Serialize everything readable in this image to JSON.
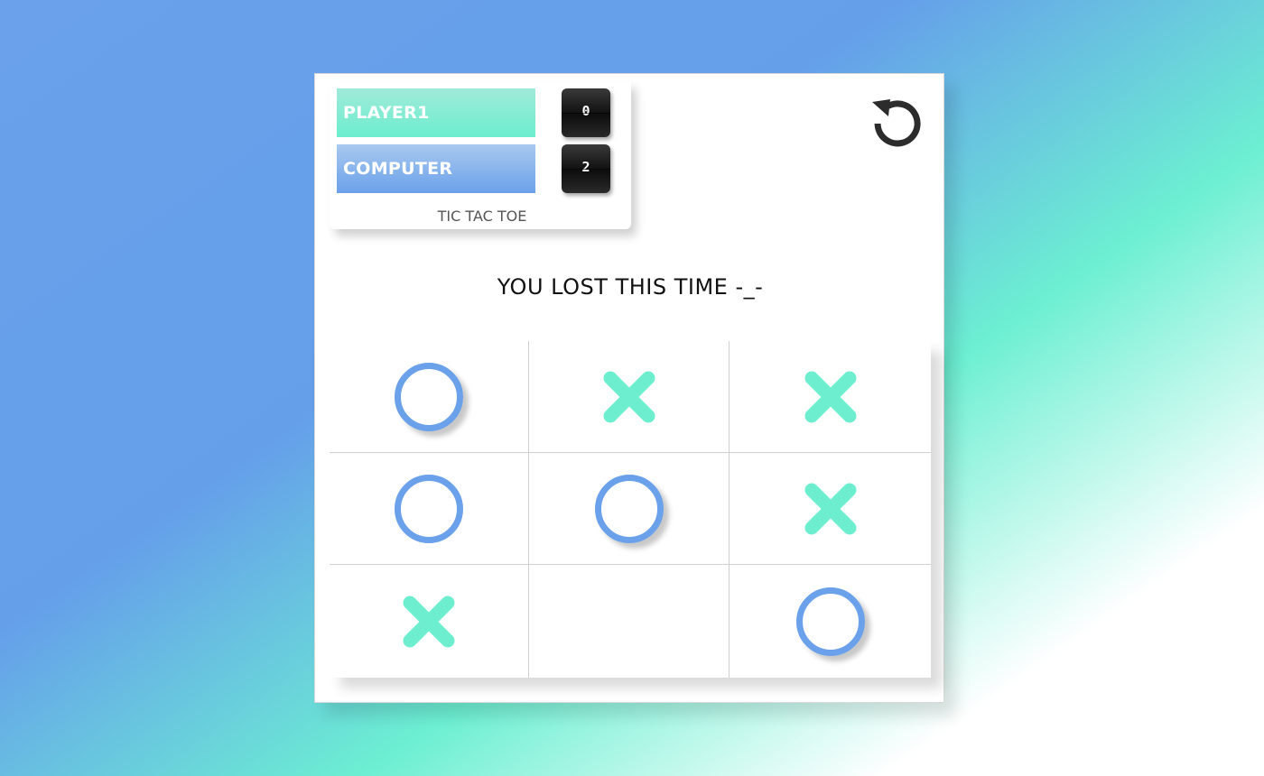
{
  "scoreboard": {
    "players": [
      {
        "name": "PLAYER1",
        "score": "0",
        "color": "#6ceecf"
      },
      {
        "name": "COMPUTER",
        "score": "2",
        "color": "#6ba1ea"
      }
    ],
    "title": "TIC TAC TOE"
  },
  "controls": {
    "restart_icon": "restart-icon"
  },
  "status": {
    "message": "YOU LOST THIS TIME -_-"
  },
  "board": {
    "cells": [
      "O",
      "X",
      "X",
      "O",
      "O",
      "X",
      "X",
      "",
      "O"
    ],
    "o_color": "#6aa1ea",
    "x_color": "#6ceecf"
  }
}
